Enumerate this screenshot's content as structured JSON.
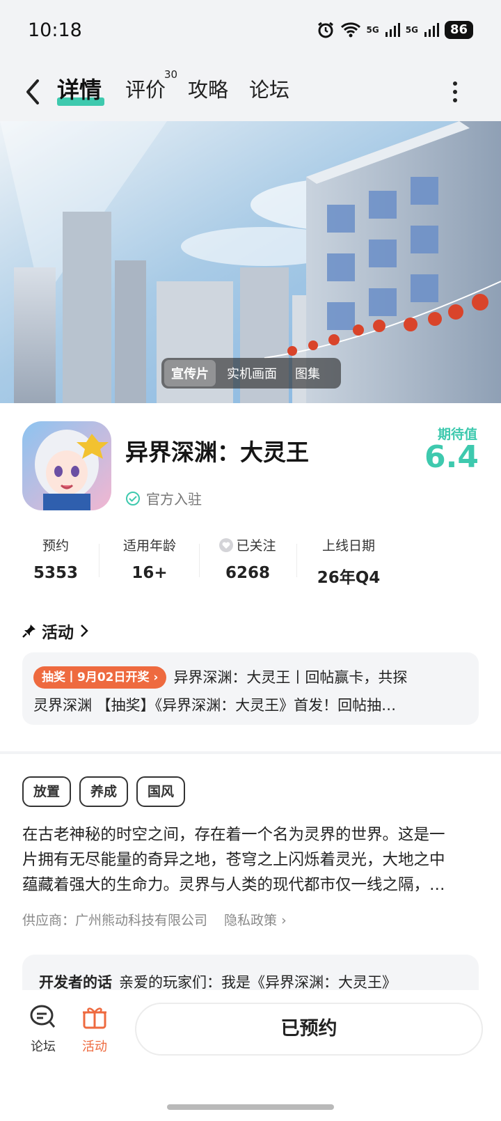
{
  "status": {
    "time": "10:18",
    "battery": "86",
    "signal1": "5G",
    "signal2": "5G"
  },
  "nav": {
    "tabs": [
      {
        "label": "详情"
      },
      {
        "label": "评价",
        "badge": "30"
      },
      {
        "label": "攻略"
      },
      {
        "label": "论坛"
      }
    ]
  },
  "media": {
    "options": [
      "宣传片",
      "实机画面",
      "图集"
    ]
  },
  "app": {
    "title": "异界深渊：大灵王",
    "verified": "官方入驻",
    "expectation_label": "期待值",
    "expectation_value": "6.4"
  },
  "stats": [
    {
      "label": "预约",
      "value": "5353"
    },
    {
      "label": "适用年龄",
      "value": "16+"
    },
    {
      "label": "已关注",
      "value": "6268"
    },
    {
      "label": "上线日期",
      "value": "26年Q4"
    }
  ],
  "activity": {
    "heading": "活动",
    "tag": "抽奖丨9月02日开奖",
    "line1": "异界深渊：大灵王丨回帖赢卡，共探",
    "line2": "灵界深渊 【抽奖】《异界深渊：大灵王》首发！回帖抽…"
  },
  "tags": [
    "放置",
    "养成",
    "国风"
  ],
  "description": {
    "line1": "在古老神秘的时空之间，存在着一个名为灵界的世界。这是一",
    "line2": "片拥有无尽能量的奇异之地，苍穹之上闪烁着灵光，大地之中",
    "line3": "蕴藏着强大的生命力。灵界与人类的现代都市仅一线之隔，…"
  },
  "supplier": {
    "text": "供应商：广州熊动科技有限公司",
    "privacy": "隐私政策"
  },
  "developer": {
    "label": "开发者的话",
    "text": "亲爱的玩家们：我是《异界深渊：大灵王》"
  },
  "bottom": {
    "forum": "论坛",
    "activity": "活动",
    "reserve": "已预约"
  },
  "colors": {
    "accent": "#3ec9ae",
    "orange": "#ee6a3f"
  }
}
